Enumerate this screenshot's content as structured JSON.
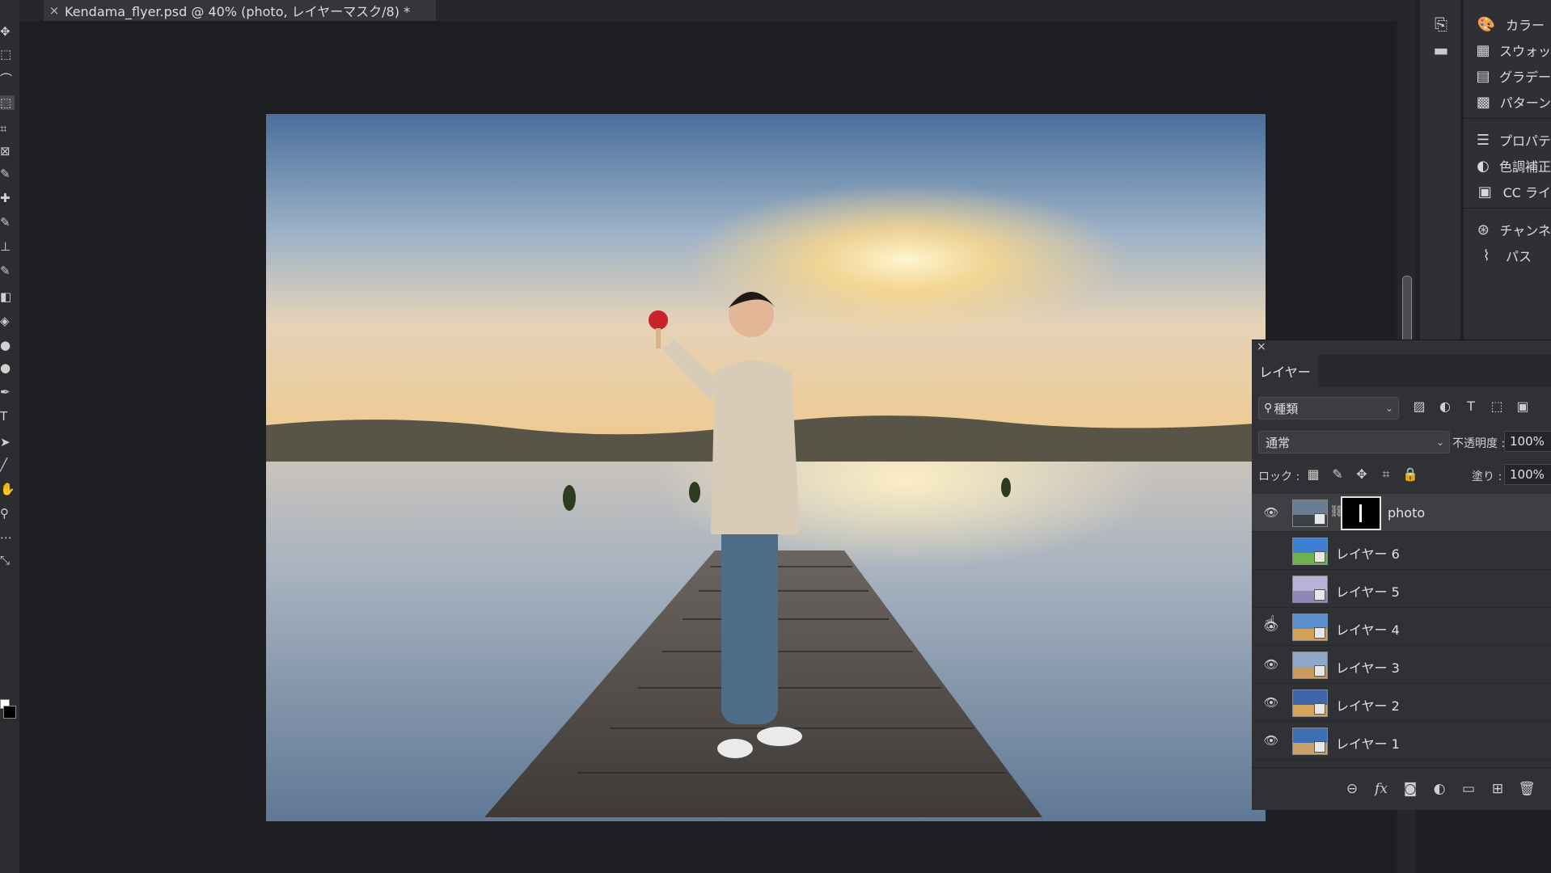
{
  "document_tab": {
    "close_glyph": "×",
    "title": "Kendama_flyer.psd @ 40% (photo, レイヤーマスク/8) *"
  },
  "tools": [
    {
      "name": "move-tool-icon",
      "glyph": "✥"
    },
    {
      "name": "marquee-tool-icon",
      "glyph": "⬚"
    },
    {
      "name": "lasso-tool-icon",
      "glyph": "⌒"
    },
    {
      "name": "object-selection-tool-icon",
      "glyph": "⬚"
    },
    {
      "name": "crop-tool-icon",
      "glyph": "⌗"
    },
    {
      "name": "frame-tool-icon",
      "glyph": "⊠"
    },
    {
      "name": "eyedropper-tool-icon",
      "glyph": "✎"
    },
    {
      "name": "healing-brush-tool-icon",
      "glyph": "✚"
    },
    {
      "name": "brush-tool-icon",
      "glyph": "✎"
    },
    {
      "name": "clone-stamp-tool-icon",
      "glyph": "⊥"
    },
    {
      "name": "history-brush-tool-icon",
      "glyph": "✎"
    },
    {
      "name": "eraser-tool-icon",
      "glyph": "◧"
    },
    {
      "name": "gradient-tool-icon",
      "glyph": "◈"
    },
    {
      "name": "blur-tool-icon",
      "glyph": "●"
    },
    {
      "name": "dodge-tool-icon",
      "glyph": "●"
    },
    {
      "name": "pen-tool-icon",
      "glyph": "✒"
    },
    {
      "name": "type-tool-icon",
      "glyph": "T"
    },
    {
      "name": "path-selection-tool-icon",
      "glyph": "➤"
    },
    {
      "name": "line-tool-icon",
      "glyph": "╱"
    },
    {
      "name": "hand-tool-icon",
      "glyph": "✋"
    },
    {
      "name": "zoom-tool-icon",
      "glyph": "⚲"
    },
    {
      "name": "more-tools-icon",
      "glyph": "⋯"
    },
    {
      "name": "swap-colors-icon",
      "glyph": "⤡"
    }
  ],
  "right_panels": [
    {
      "icon": "color-icon",
      "glyph": "🎨",
      "label": "カラー"
    },
    {
      "icon": "swatches-icon",
      "glyph": "▦",
      "label": "スウォッ"
    },
    {
      "icon": "gradients-icon",
      "glyph": "▤",
      "label": "グラデー"
    },
    {
      "icon": "patterns-icon",
      "glyph": "▩",
      "label": "パターン"
    },
    {
      "icon": "properties-icon",
      "glyph": "☰",
      "label": "プロパテ"
    },
    {
      "icon": "adjustments-icon",
      "glyph": "◐",
      "label": "色調補正"
    },
    {
      "icon": "cc-libraries-icon",
      "glyph": "▣",
      "label": "CC ライ"
    },
    {
      "icon": "channels-icon",
      "glyph": "⊛",
      "label": "チャンネ"
    },
    {
      "icon": "paths-icon",
      "glyph": "⌇",
      "label": "パス"
    }
  ],
  "strip_icons": [
    {
      "name": "history-icon",
      "glyph": "⎘"
    },
    {
      "name": "comments-icon",
      "glyph": "▬"
    }
  ],
  "layers_panel": {
    "close_glyph": "×",
    "tab_label": "レイヤー",
    "filter_label": "種類",
    "filter_search_glyph": "⚲",
    "blend_mode": "通常",
    "opacity_label": "不透明度 :",
    "opacity_value": "100%",
    "lock_label": "ロック :",
    "fill_label": "塗り :",
    "fill_value": "100%",
    "filter_icons": [
      {
        "name": "pixel-filter-icon",
        "glyph": "▨"
      },
      {
        "name": "adjustment-filter-icon",
        "glyph": "◐"
      },
      {
        "name": "type-filter-icon",
        "glyph": "T"
      },
      {
        "name": "shape-filter-icon",
        "glyph": "⬚"
      },
      {
        "name": "smart-object-filter-icon",
        "glyph": "▣"
      }
    ],
    "lock_icons": [
      {
        "name": "lock-transparent-icon",
        "glyph": "▦"
      },
      {
        "name": "lock-image-icon",
        "glyph": "✎"
      },
      {
        "name": "lock-position-icon",
        "glyph": "✥"
      },
      {
        "name": "lock-artboard-icon",
        "glyph": "⌗"
      },
      {
        "name": "lock-all-icon",
        "glyph": "🔒"
      }
    ],
    "layers": [
      {
        "name": "photo",
        "visible": true,
        "selected": true,
        "has_mask": true,
        "sky": "#6a7c92",
        "ground": "#3b3f46"
      },
      {
        "name": "レイヤー 6",
        "visible": false,
        "selected": false,
        "has_mask": false,
        "sky": "#3f7fd1",
        "ground": "#6fb14e"
      },
      {
        "name": "レイヤー 5",
        "visible": false,
        "selected": false,
        "has_mask": false,
        "sky": "#b9b2d8",
        "ground": "#8f87b5"
      },
      {
        "name": "レイヤー 4",
        "visible": true,
        "selected": false,
        "has_mask": false,
        "sky": "#5a8fcf",
        "ground": "#d2a357"
      },
      {
        "name": "レイヤー 3",
        "visible": true,
        "selected": false,
        "has_mask": false,
        "sky": "#8fa8c7",
        "ground": "#c79a62"
      },
      {
        "name": "レイヤー 2",
        "visible": true,
        "selected": false,
        "has_mask": false,
        "sky": "#3c66a8",
        "ground": "#d6a35c"
      },
      {
        "name": "レイヤー 1",
        "visible": true,
        "selected": false,
        "has_mask": false,
        "sky": "#3d6fb5",
        "ground": "#c9a26b"
      }
    ],
    "eye_glyph": "👁",
    "link_glyph": "⛓",
    "bottom_icons": [
      {
        "name": "link-layers-icon",
        "glyph": "⊖"
      },
      {
        "name": "layer-style-fx-icon",
        "glyph": "fx"
      },
      {
        "name": "add-mask-icon",
        "glyph": "◙"
      },
      {
        "name": "new-adjustment-layer-icon",
        "glyph": "◐"
      },
      {
        "name": "new-group-folder-icon",
        "glyph": "▭"
      },
      {
        "name": "new-layer-icon",
        "glyph": "⊞"
      },
      {
        "name": "delete-layer-trash-icon",
        "glyph": "🗑"
      }
    ]
  },
  "cursor_glyph": "☝",
  "colors": {
    "accent_selected_row": "#3d3f43",
    "canvas_sky_top": "#4a6f9c",
    "sun": "#ffe9a8"
  }
}
